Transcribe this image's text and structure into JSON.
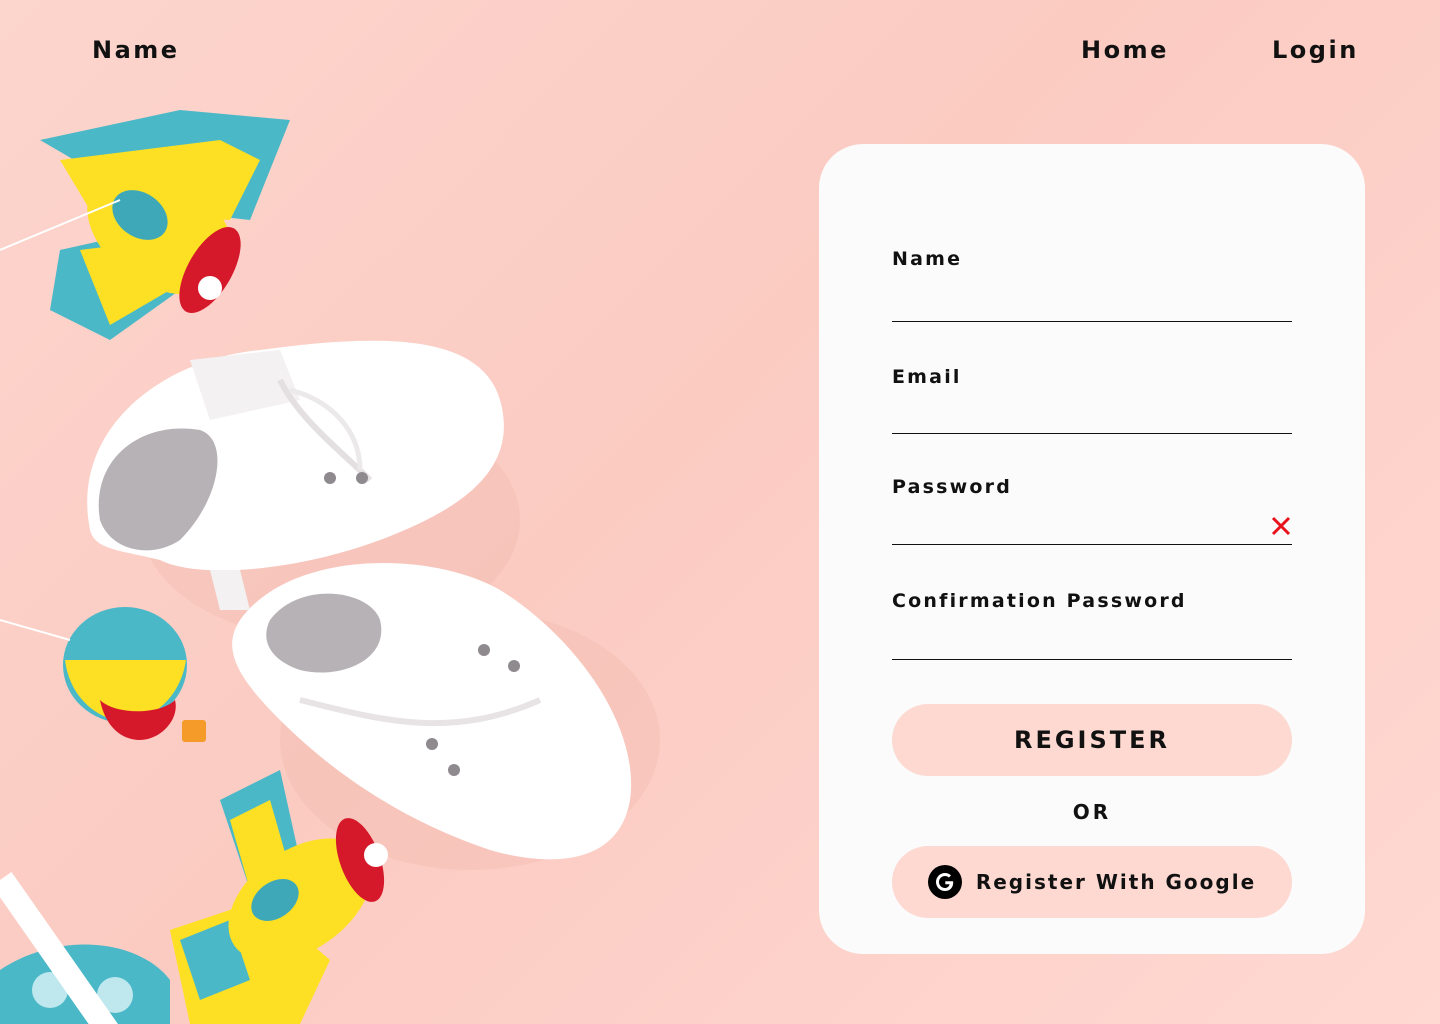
{
  "nav": {
    "brand": "Name",
    "home": "Home",
    "login": "Login"
  },
  "form": {
    "name_label": "Name",
    "name_value": "",
    "email_label": "Email",
    "email_value": "",
    "password_label": "Password",
    "password_value": "",
    "confirm_label": "Confirmation Password",
    "confirm_value": "",
    "register_label": "REGISTER",
    "or_label": "OR",
    "google_label": "Register With Google"
  },
  "icons": {
    "clear": "close-icon",
    "google": "google-icon"
  },
  "colors": {
    "background": "#fcd5cd",
    "card": "#fbfbfb",
    "button": "#fdd9d1",
    "error": "#e8121c",
    "text": "#111111"
  }
}
